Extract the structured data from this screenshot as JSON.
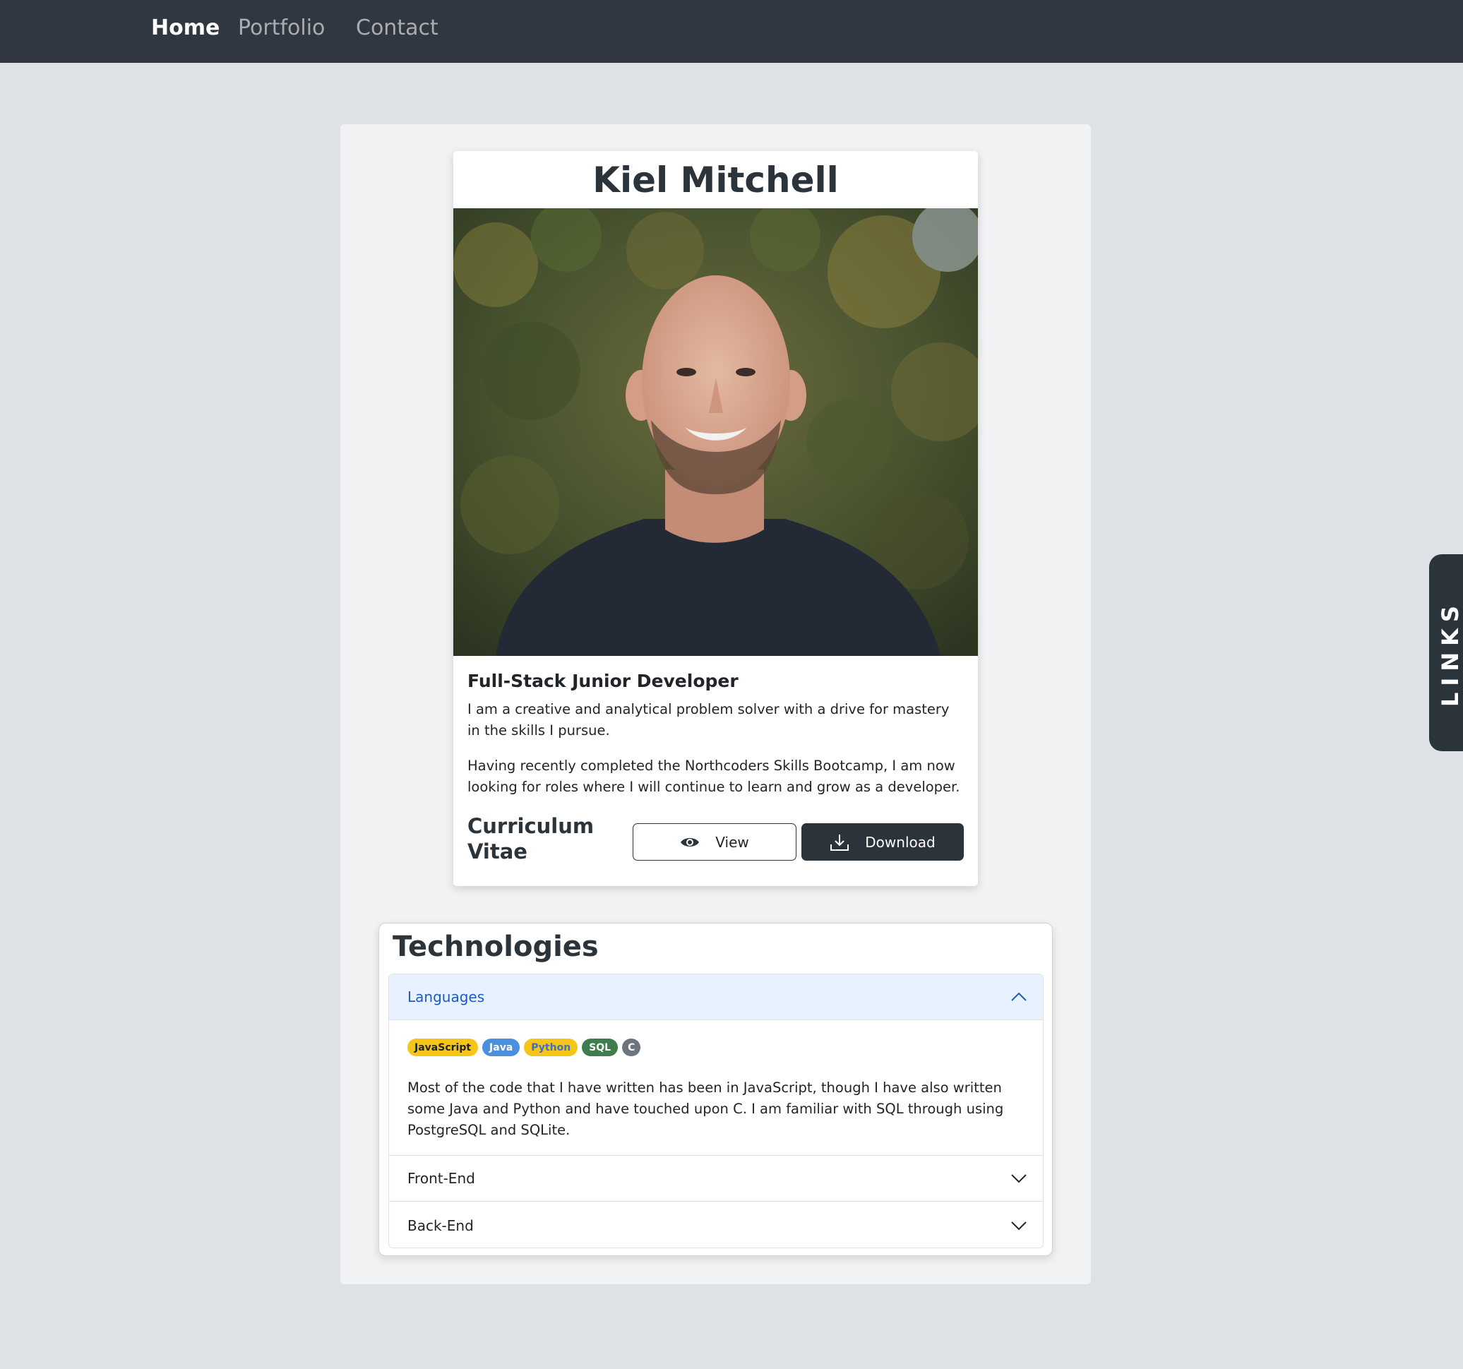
{
  "nav": {
    "items": [
      {
        "label": "Home",
        "active": true
      },
      {
        "label": "Portfolio",
        "active": false
      },
      {
        "label": "Contact",
        "active": false
      }
    ]
  },
  "profile": {
    "name": "Kiel Mitchell",
    "job_title": "Full-Stack Junior Developer",
    "bio_1": "I am a creative and analytical problem solver with a drive for mastery in the skills I pursue.",
    "bio_2": "Having recently completed the Northcoders Skills Bootcamp, I am now looking for roles where I will continue to learn and grow as a developer.",
    "cv_label": "Curriculum Vitae",
    "view_label": "View",
    "download_label": "Download"
  },
  "technologies": {
    "title": "Technologies",
    "sections": [
      {
        "label": "Languages",
        "open": true,
        "badges": [
          {
            "label": "JavaScript",
            "bg": "#f5c518",
            "fg": "#212529"
          },
          {
            "label": "Java",
            "bg": "#4a8fe0",
            "fg": "#ffffff"
          },
          {
            "label": "Python",
            "bg": "#f5c518",
            "fg": "#3f6fc4"
          },
          {
            "label": "SQL",
            "bg": "#3f7d4e",
            "fg": "#ffffff"
          },
          {
            "label": "C",
            "bg": "#6c757d",
            "fg": "#ffffff"
          }
        ],
        "text": "Most of the code that I have written has been in JavaScript, though I have also written some Java and Python and have touched upon C. I am familiar with SQL through using PostgreSQL and SQLite."
      },
      {
        "label": "Front-End",
        "open": false
      },
      {
        "label": "Back-End",
        "open": false
      }
    ]
  },
  "links_tab": {
    "label": "LINKS"
  },
  "colors": {
    "navbar": "#303741",
    "page_bg": "#dee2e6",
    "dark": "#2b333b",
    "accordion_open_bg": "#e7f1ff",
    "accordion_open_text": "#1c5cc2"
  }
}
